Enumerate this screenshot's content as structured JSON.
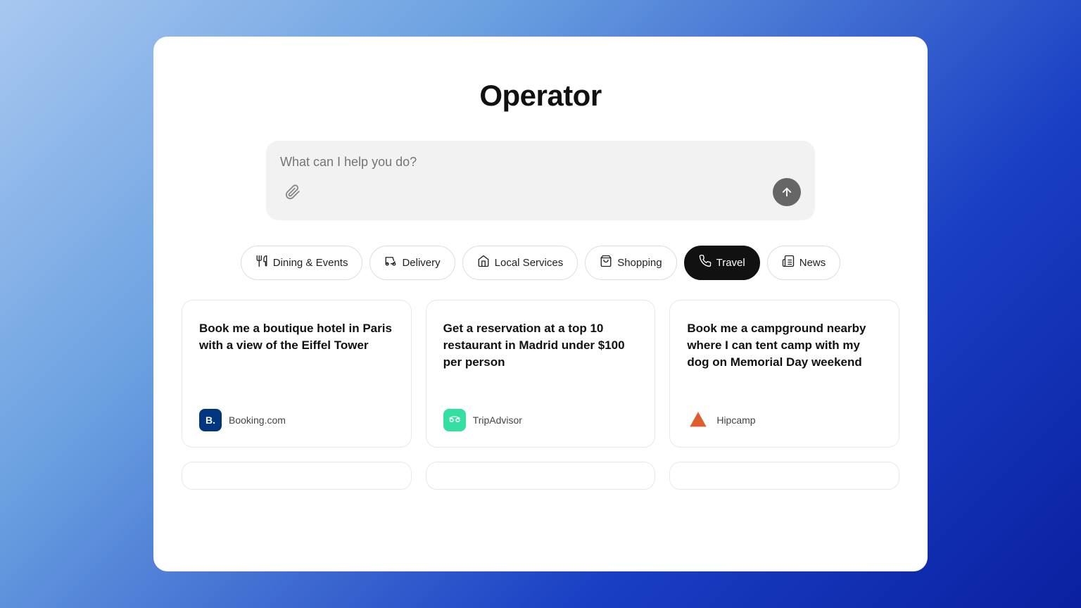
{
  "app": {
    "title": "Operator"
  },
  "search": {
    "placeholder": "What can I help you do?"
  },
  "tabs": [
    {
      "id": "dining",
      "label": "Dining & Events",
      "icon": "🍽",
      "active": false
    },
    {
      "id": "delivery",
      "label": "Delivery",
      "icon": "🛵",
      "active": false
    },
    {
      "id": "local-services",
      "label": "Local Services",
      "icon": "🏪",
      "active": false
    },
    {
      "id": "shopping",
      "label": "Shopping",
      "icon": "🛍",
      "active": false
    },
    {
      "id": "travel",
      "label": "Travel",
      "icon": "✈",
      "active": true
    },
    {
      "id": "news",
      "label": "News",
      "icon": "📰",
      "active": false
    }
  ],
  "cards": [
    {
      "id": "card-1",
      "text": "Book me a boutique hotel in Paris with a view of the Eiffel Tower",
      "brand": "Booking.com",
      "brand_class": "booking",
      "brand_letter": "B."
    },
    {
      "id": "card-2",
      "text": "Get a reservation at a top 10 restaurant in Madrid under $100 per person",
      "brand": "TripAdvisor",
      "brand_class": "tripadvisor",
      "brand_letter": "🦉"
    },
    {
      "id": "card-3",
      "text": "Book me a campground nearby where I can tent camp with my dog on Memorial Day weekend",
      "brand": "Hipcamp",
      "brand_class": "hipcamp",
      "brand_letter": "⛺"
    }
  ]
}
